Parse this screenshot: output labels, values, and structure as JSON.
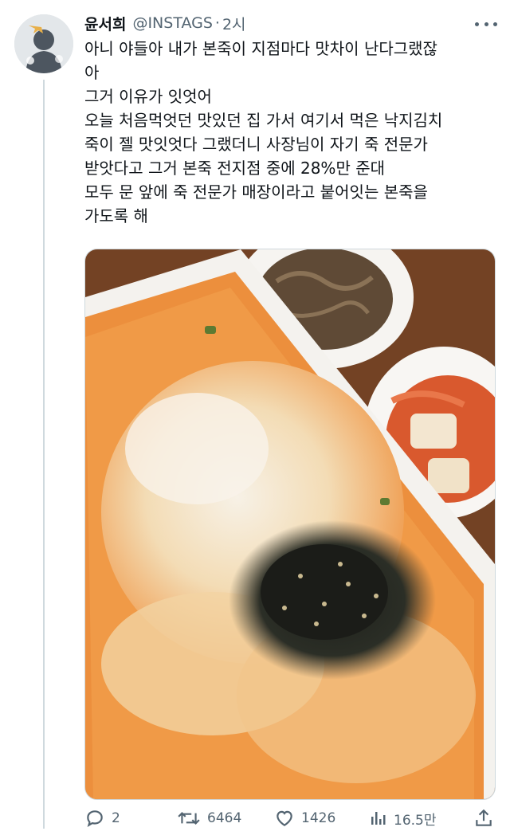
{
  "tweet": {
    "author_name": "윤서희",
    "author_handle": "@INSTAGS",
    "separator": "·",
    "time": "2시",
    "text_lines": [
      "아니 야들아 내가 본죽이 지점마다 맛차이 난다그랬잖",
      "아",
      "그거 이유가 잇엇어",
      "오늘 처음먹엇던 맛있던 집 가서 여기서 먹은 낙지김치",
      "죽이 젤 맛잇엇다 그랬더니 사장님이 자기 죽 전문가",
      "받앗다고 그거 본죽 전지점 중에 28%만 준대",
      "모두 문 앞에 죽 전문가 매장이라고 붙어잇는 본죽을",
      "가도록 해"
    ]
  },
  "actions": {
    "reply_count": "2",
    "retweet_count": "6464",
    "like_count": "1426",
    "views_count": "16.5만"
  },
  "colors": {
    "text": "#0f1419",
    "muted": "#536471",
    "border": "#cfd9de"
  },
  "icons": [
    "reply-icon",
    "retweet-icon",
    "like-icon",
    "views-icon",
    "share-icon",
    "more-icon"
  ]
}
